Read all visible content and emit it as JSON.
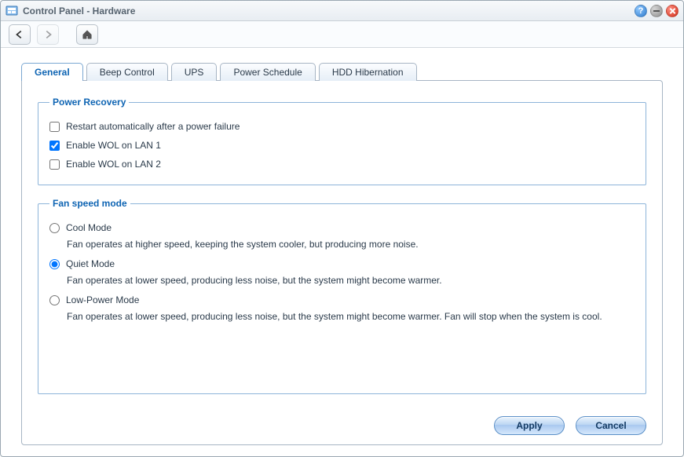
{
  "window": {
    "title": "Control Panel - Hardware"
  },
  "tabs": [
    {
      "label": "General"
    },
    {
      "label": "Beep Control"
    },
    {
      "label": "UPS"
    },
    {
      "label": "Power Schedule"
    },
    {
      "label": "HDD Hibernation"
    }
  ],
  "power_recovery": {
    "legend": "Power Recovery",
    "restart": {
      "label": "Restart automatically after a power failure",
      "checked": false
    },
    "wol1": {
      "label": "Enable WOL on LAN 1",
      "checked": true
    },
    "wol2": {
      "label": "Enable WOL on LAN 2",
      "checked": false
    }
  },
  "fan": {
    "legend": "Fan speed mode",
    "selected": "quiet",
    "cool": {
      "label": "Cool Mode",
      "desc": "Fan operates at higher speed, keeping the system cooler, but producing more noise."
    },
    "quiet": {
      "label": "Quiet Mode",
      "desc": "Fan operates at lower speed, producing less noise, but the system might become warmer."
    },
    "low": {
      "label": "Low-Power Mode",
      "desc": "Fan operates at lower speed, producing less noise, but the system might become warmer. Fan will stop when the system is cool."
    }
  },
  "buttons": {
    "apply": "Apply",
    "cancel": "Cancel"
  }
}
